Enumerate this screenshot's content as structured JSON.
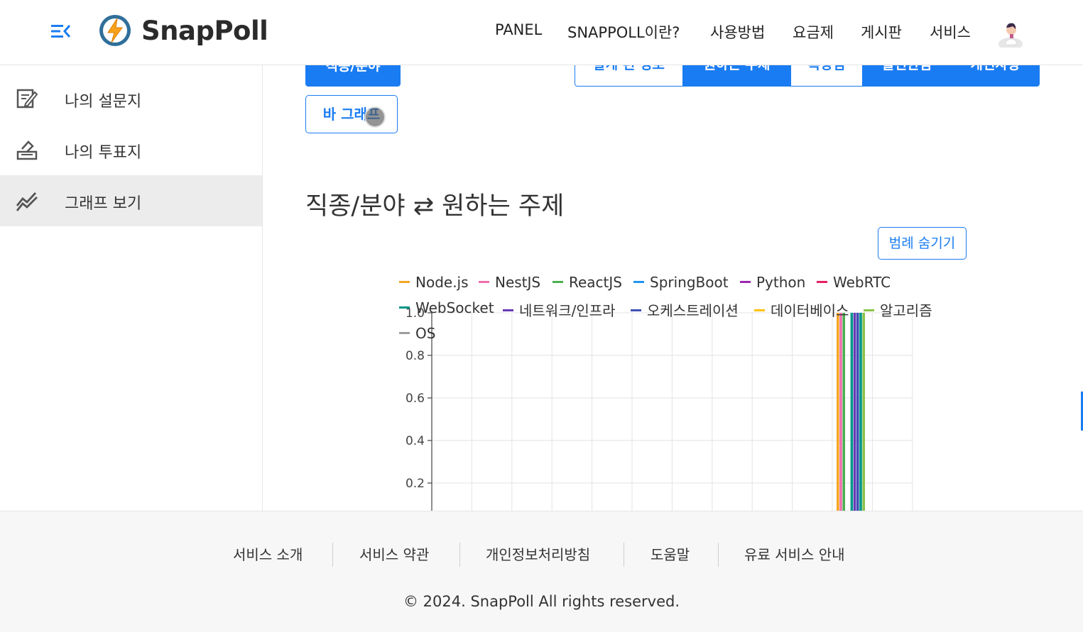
{
  "header": {
    "brand": "SnapPoll",
    "nav": [
      "PANEL",
      "SNAPPOLL이란?",
      "사용방법",
      "요금제",
      "게시판",
      "서비스"
    ]
  },
  "sidebar": {
    "items": [
      {
        "label": "나의 설문지",
        "icon": "survey-edit-icon",
        "active": false
      },
      {
        "label": "나의 투표지",
        "icon": "ballot-box-icon",
        "active": false
      },
      {
        "label": "그래프 보기",
        "icon": "chart-line-icon",
        "active": true
      }
    ]
  },
  "main": {
    "category_button": "직종/분야",
    "tabs": [
      {
        "label": "알게 된 경로",
        "active": false
      },
      {
        "label": "원하는 주제",
        "active": true
      },
      {
        "label": "특장점",
        "active": false
      },
      {
        "label": "불편한점",
        "active": true
      },
      {
        "label": "개선사항",
        "active": true
      }
    ],
    "bar_graph_button": "바 그래프",
    "chart_title": "직종/분야 ⇄ 원하는 주제",
    "legend_toggle": "범례 숨기기"
  },
  "chart_data": {
    "type": "bar",
    "legend": [
      {
        "name": "Node.js",
        "color": "#f5a623"
      },
      {
        "name": "NestJS",
        "color": "#f06fae"
      },
      {
        "name": "ReactJS",
        "color": "#4caf50"
      },
      {
        "name": "SpringBoot",
        "color": "#2196f3"
      },
      {
        "name": "Python",
        "color": "#9c27b0"
      },
      {
        "name": "WebRTC",
        "color": "#e91e63"
      },
      {
        "name": "WebSocket",
        "color": "#009688"
      },
      {
        "name": "네트워크/인프라",
        "color": "#673ab7"
      },
      {
        "name": "오케스트레이션",
        "color": "#3f51b5"
      },
      {
        "name": "데이터베이스",
        "color": "#ffc107"
      },
      {
        "name": "알고리즘",
        "color": "#8bc34a"
      },
      {
        "name": "OS",
        "color": "#9e9e9e"
      }
    ],
    "y_ticks": [
      "1.0",
      "0.8",
      "0.6",
      "0.4",
      "0.2"
    ],
    "ylim": [
      0,
      1.0
    ],
    "grid": true,
    "bars": [
      {
        "series": "Node.js",
        "value": 1.0
      },
      {
        "series": "NestJS",
        "value": 1.0
      },
      {
        "series": "ReactJS",
        "value": 1.0
      },
      {
        "series": "WebSocket",
        "value": 1.0
      },
      {
        "series": "네트워크/인프라",
        "value": 1.0
      },
      {
        "series": "오케스트레이션",
        "value": 1.0
      },
      {
        "series": "WebSocket",
        "value": 1.0
      },
      {
        "series": "알고리즘",
        "value": 1.0
      }
    ]
  },
  "footer": {
    "links": [
      "서비스 소개",
      "서비스 약관",
      "개인정보처리방침",
      "도움말",
      "유료 서비스 안내"
    ],
    "copyright": "© 2024. SnapPoll All rights reserved."
  }
}
